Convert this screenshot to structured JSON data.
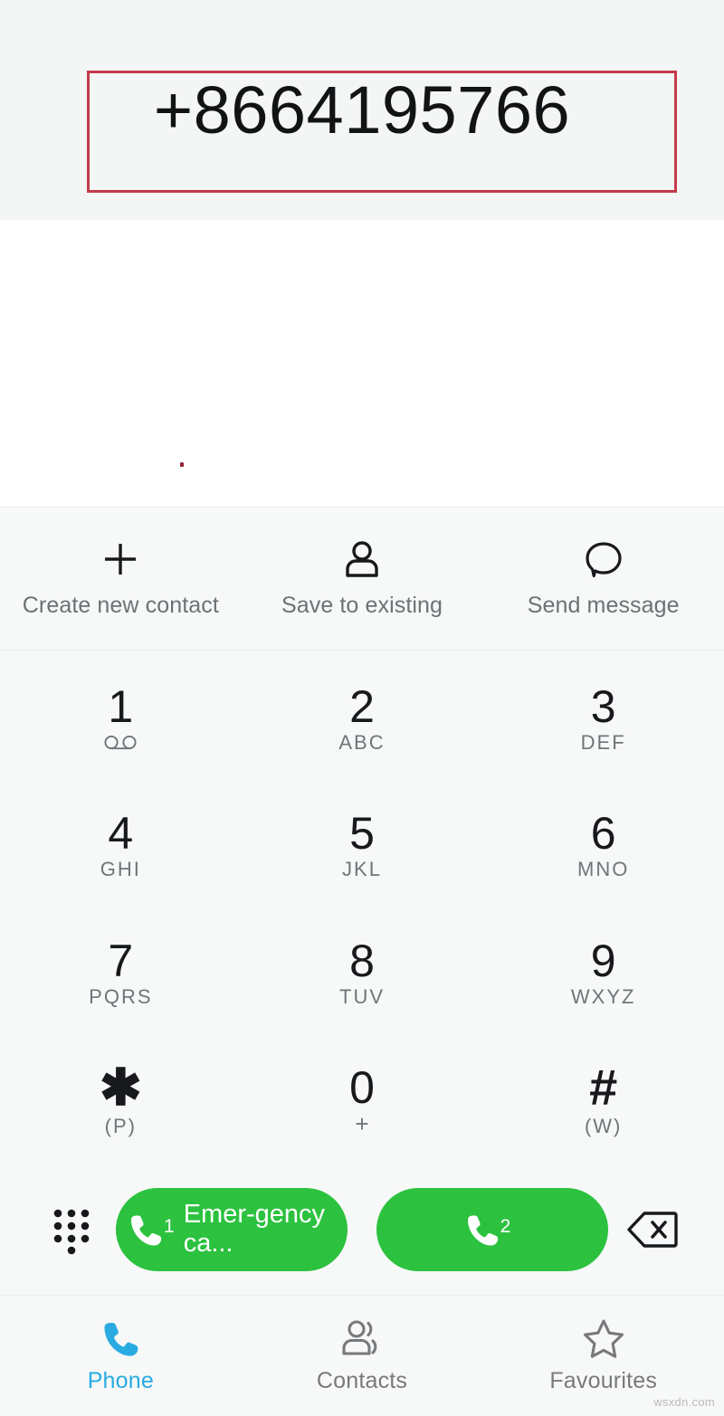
{
  "display": {
    "phone_number": "+8664195766",
    "annotation_color": "#c43b4a"
  },
  "quick_actions": [
    {
      "icon": "plus-icon",
      "label": "Create new contact"
    },
    {
      "icon": "person-icon",
      "label": "Save to existing"
    },
    {
      "icon": "message-bubble-icon",
      "label": "Send message"
    }
  ],
  "dialpad": {
    "rows": [
      [
        {
          "digit": "1",
          "sub": "",
          "icon": "voicemail-icon"
        },
        {
          "digit": "2",
          "sub": "ABC",
          "icon": ""
        },
        {
          "digit": "3",
          "sub": "DEF",
          "icon": ""
        }
      ],
      [
        {
          "digit": "4",
          "sub": "GHI",
          "icon": ""
        },
        {
          "digit": "5",
          "sub": "JKL",
          "icon": ""
        },
        {
          "digit": "6",
          "sub": "MNO",
          "icon": ""
        }
      ],
      [
        {
          "digit": "7",
          "sub": "PQRS",
          "icon": ""
        },
        {
          "digit": "8",
          "sub": "TUV",
          "icon": ""
        },
        {
          "digit": "9",
          "sub": "WXYZ",
          "icon": ""
        }
      ],
      [
        {
          "digit": "✱",
          "sub": "(P)",
          "icon": ""
        },
        {
          "digit": "0",
          "sub": "+",
          "icon": ""
        },
        {
          "digit": "#",
          "sub": "(W)",
          "icon": ""
        }
      ]
    ]
  },
  "call_bar": {
    "keypad_toggle_icon": "dialpad-dots-icon",
    "backspace_icon": "backspace-icon",
    "buttons": [
      {
        "sim": "1",
        "label": "Emer-gency ca...",
        "color": "#2cc23f",
        "icon": "phone-handset-icon"
      },
      {
        "sim": "2",
        "label": "",
        "color": "#2cc23f",
        "icon": "phone-handset-icon"
      }
    ]
  },
  "bottom_nav": {
    "active_color": "#29abe2",
    "items": [
      {
        "icon": "phone-handset-icon",
        "label": "Phone",
        "active": true
      },
      {
        "icon": "contacts-people-icon",
        "label": "Contacts",
        "active": false
      },
      {
        "icon": "star-outline-icon",
        "label": "Favourites",
        "active": false
      }
    ]
  },
  "watermark": "wsxdn.com"
}
